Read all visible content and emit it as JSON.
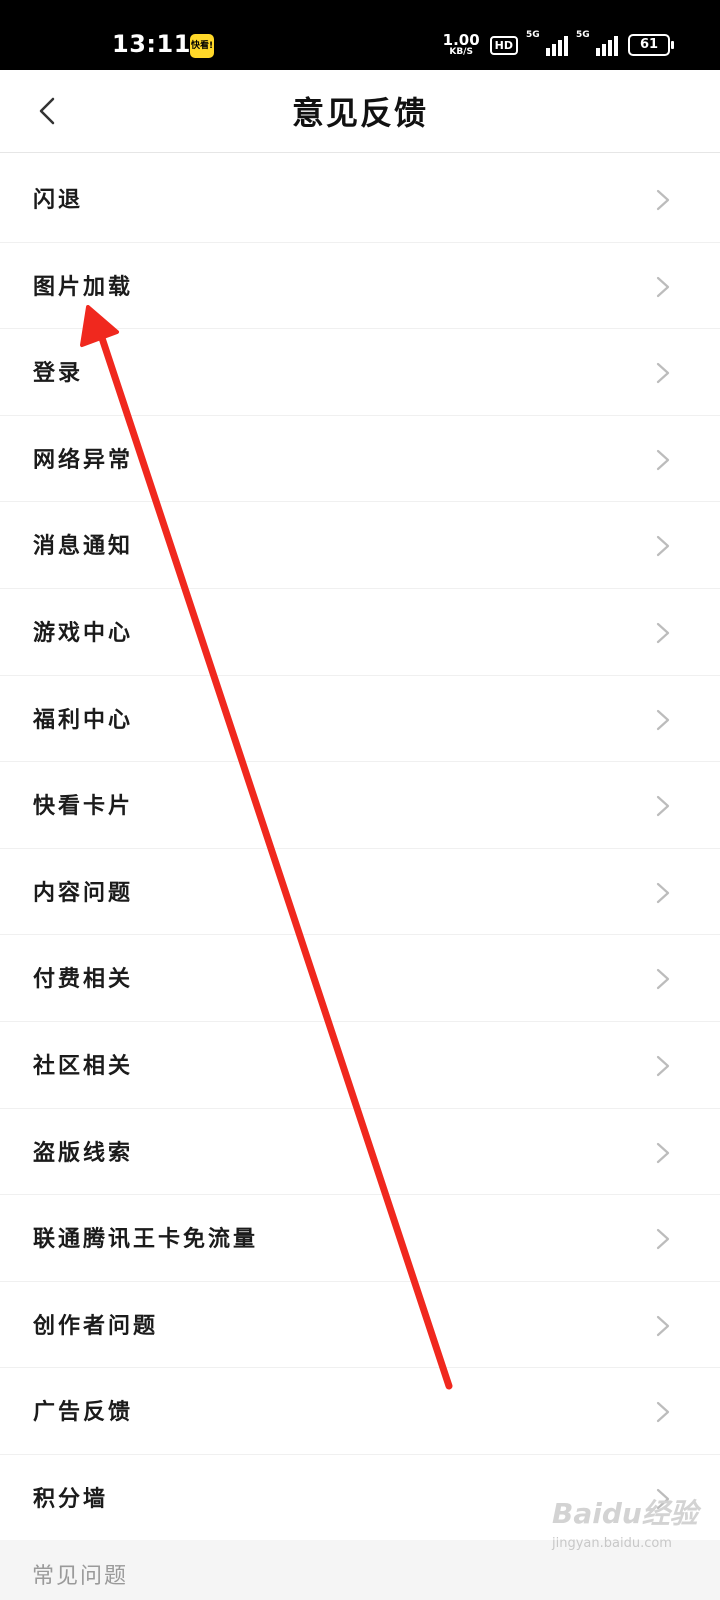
{
  "status_bar": {
    "time": "13:11",
    "app_badge": "快看!",
    "net_speed_value": "1.00",
    "net_speed_unit": "KB/S",
    "hd_label": "HD",
    "signal1_label": "5G",
    "signal2_label": "5G",
    "battery": "61"
  },
  "header": {
    "title": "意见反馈"
  },
  "feedback_items": [
    {
      "label": "闪退"
    },
    {
      "label": "图片加载"
    },
    {
      "label": "登录"
    },
    {
      "label": "网络异常"
    },
    {
      "label": "消息通知"
    },
    {
      "label": "游戏中心"
    },
    {
      "label": "福利中心"
    },
    {
      "label": "快看卡片"
    },
    {
      "label": "内容问题"
    },
    {
      "label": "付费相关"
    },
    {
      "label": "社区相关"
    },
    {
      "label": "盗版线索"
    },
    {
      "label": "联通腾讯王卡免流量"
    },
    {
      "label": "创作者问题"
    },
    {
      "label": "广告反馈"
    },
    {
      "label": "积分墙"
    }
  ],
  "faq_section": {
    "title": "常见问题"
  },
  "watermark": {
    "brand": "Baidu经验",
    "url": "jingyan.baidu.com"
  },
  "colors": {
    "annotation_arrow": "#f0281e",
    "status_bar_bg": "#000000",
    "app_badge_bg": "#ffd829"
  }
}
